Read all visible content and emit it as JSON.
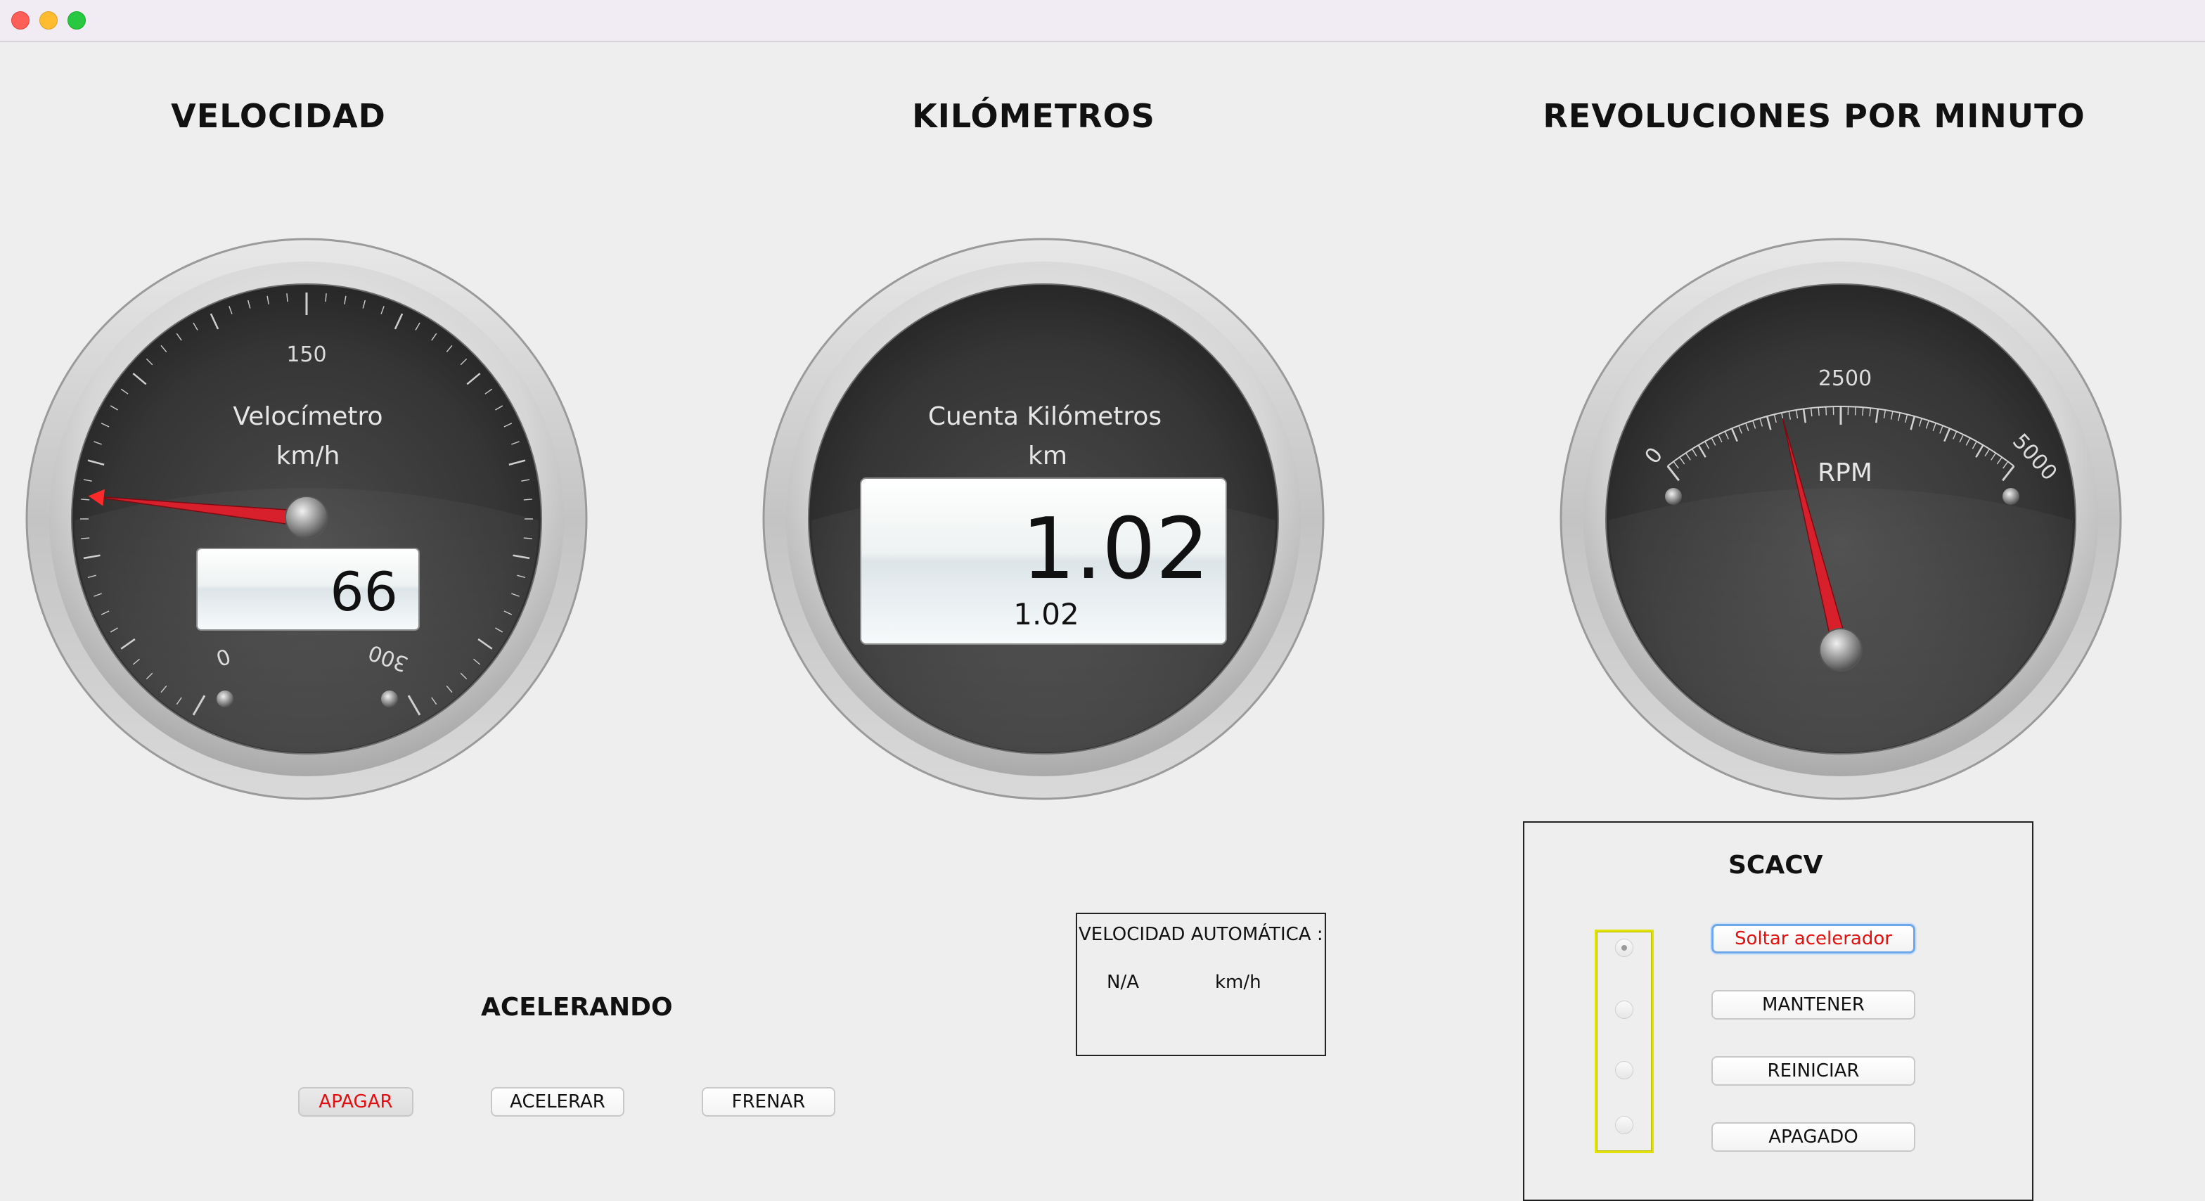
{
  "window": {
    "controls": [
      "close",
      "minimize",
      "zoom"
    ]
  },
  "headings": {
    "speed": "VELOCIDAD",
    "km": "KILÓMETROS",
    "rpm": "REVOLUCIONES POR MINUTO"
  },
  "speedometer": {
    "title": "Velocímetro",
    "unit": "km/h",
    "ticks": {
      "min": "0",
      "mid": "150",
      "max": "300"
    },
    "range": [
      0,
      300
    ],
    "value": 66,
    "display": "66"
  },
  "odometer": {
    "title": "Cuenta Kilómetros",
    "unit": "km",
    "value": 1.02,
    "display": "1.02",
    "sub_display": "1.02"
  },
  "tachometer": {
    "title": "RPM",
    "ticks": {
      "min": "0",
      "mid": "2500",
      "max": "5000"
    },
    "range": [
      0,
      5000
    ],
    "value": 1700
  },
  "auto_speed": {
    "label": "VELOCIDAD AUTOMÁTICA :",
    "value": "N/A",
    "unit": "km/h"
  },
  "status": {
    "text": "ACELERANDO"
  },
  "engine_buttons": {
    "off": "APAGAR",
    "accelerate": "ACELERAR",
    "brake": "FRENAR"
  },
  "scacv": {
    "title": "SCACV",
    "buttons": {
      "release": "Soltar acelerador",
      "keep": "MANTENER",
      "restart": "REINICIAR",
      "off": "APAGADO"
    },
    "selected_index": 0
  },
  "colors": {
    "needle": "#d8202c",
    "active_text": "#e01010",
    "yellow_frame": "#e8e800",
    "focus_ring": "#6ea7ea"
  }
}
